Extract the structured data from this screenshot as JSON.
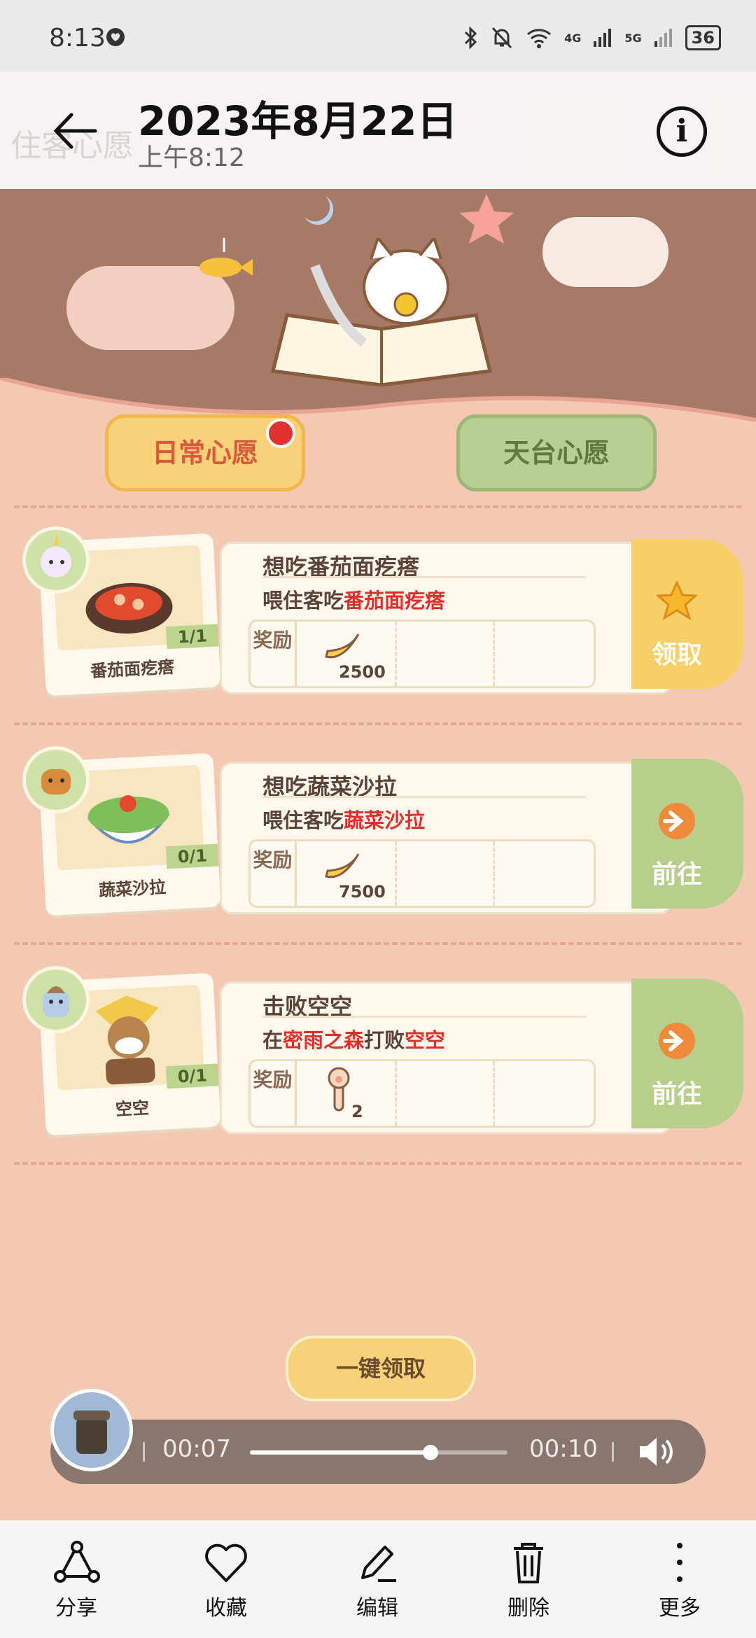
{
  "status_bar": {
    "time": "8:13",
    "battery": "36",
    "net_1": "4G",
    "net_2": "5G"
  },
  "header": {
    "title": "2023年8月22日",
    "subtitle": "上午8:12",
    "ghost_text": "住客心愿"
  },
  "tabs": {
    "daily": "日常心愿",
    "rooftop": "天台心愿"
  },
  "tasks": [
    {
      "title": "想吃番茄面疙瘩",
      "desc_prefix": "喂住客吃",
      "desc_highlight": "番茄面疙瘩",
      "reward_label": "奖励",
      "reward_amount": "2500",
      "item_name": "番茄面疙瘩",
      "progress": "1/1",
      "action": "领取"
    },
    {
      "title": "想吃蔬菜沙拉",
      "desc_prefix": "喂住客吃",
      "desc_highlight": "蔬菜沙拉",
      "reward_label": "奖励",
      "reward_amount": "7500",
      "item_name": "蔬菜沙拉",
      "progress": "0/1",
      "action": "前往"
    },
    {
      "title": "击败空空",
      "desc_part1": "在",
      "desc_hl1": "密雨之森",
      "desc_part2": "打败",
      "desc_hl2": "空空",
      "reward_label": "奖励",
      "reward_amount": "2",
      "item_name": "空空",
      "progress": "0/1",
      "action": "前往"
    }
  ],
  "claim_all": "一键领取",
  "player": {
    "current": "00:07",
    "total": "00:10",
    "progress": 0.7
  },
  "toolbar": [
    {
      "label": "分享",
      "icon": "share-icon"
    },
    {
      "label": "收藏",
      "icon": "heart-icon"
    },
    {
      "label": "编辑",
      "icon": "pencil-icon"
    },
    {
      "label": "删除",
      "icon": "trash-icon"
    },
    {
      "label": "更多",
      "icon": "more-icon"
    }
  ],
  "colors": {
    "accent_red": "#e0302d",
    "claim_yellow": "#f8cf67",
    "go_green": "#b7cf8b"
  }
}
